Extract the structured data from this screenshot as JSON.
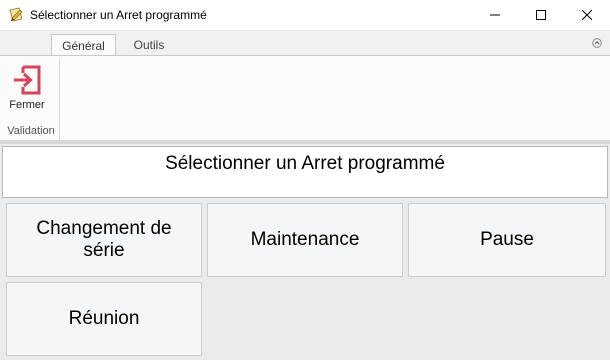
{
  "window": {
    "title": "Sélectionner un Arret programmé",
    "icon": "pencil-note-icon"
  },
  "ribbon": {
    "tabs": [
      {
        "label": "Général",
        "active": true
      },
      {
        "label": "Outils",
        "active": false
      }
    ],
    "group": {
      "label": "Validation",
      "button": {
        "label": "Fermer",
        "icon": "exit-icon",
        "color": "#d9435a"
      }
    }
  },
  "main": {
    "header": "Sélectionner un Arret programmé",
    "options": [
      {
        "label": "Changement de série"
      },
      {
        "label": "Maintenance"
      },
      {
        "label": "Pause"
      },
      {
        "label": "Réunion"
      }
    ]
  }
}
